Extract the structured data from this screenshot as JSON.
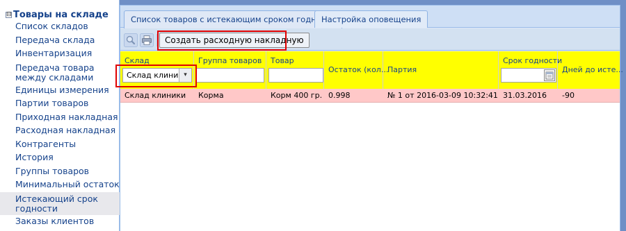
{
  "sidebar": {
    "title": "Товары на складе",
    "expander": "⊟",
    "items": [
      {
        "label": "Список складов",
        "lines": 1
      },
      {
        "label": "Передача склада",
        "lines": 1
      },
      {
        "label": "Инвентаризация",
        "lines": 1
      },
      {
        "label": "Передача товара между складами",
        "lines": 2
      },
      {
        "label": "Единицы измерения",
        "lines": 1
      },
      {
        "label": "Партии товаров",
        "lines": 1
      },
      {
        "label": "Приходная накладная",
        "lines": 1
      },
      {
        "label": "Расходная накладная",
        "lines": 1
      },
      {
        "label": "Контрагенты",
        "lines": 1
      },
      {
        "label": "История",
        "lines": 1
      },
      {
        "label": "Группы товаров",
        "lines": 1
      },
      {
        "label": "Минимальный остаток",
        "lines": 1
      },
      {
        "label": "Истекающий срок годности",
        "lines": 2,
        "active": true
      },
      {
        "label": "Заказы клиентов",
        "lines": 1
      }
    ]
  },
  "tabs": [
    {
      "label": "Список товаров с истекающим сроком годности",
      "active": true
    },
    {
      "label": "Настройка оповещения",
      "active": false
    }
  ],
  "toolbar": {
    "search_icon": "magnifier-icon",
    "print_icon": "printer-icon",
    "create_button": "Создать расходную накладную"
  },
  "grid": {
    "columns": [
      {
        "label": "Склад",
        "filter": "combo",
        "filter_value": "Склад клиники"
      },
      {
        "label": "Группа товаров",
        "filter": "text",
        "filter_value": ""
      },
      {
        "label": "Товар",
        "filter": "text",
        "filter_value": ""
      },
      {
        "label": "Остаток (кол...",
        "filter": "none"
      },
      {
        "label": "Партия",
        "filter": "none"
      },
      {
        "label": "Срок годности",
        "filter": "date",
        "filter_value": ""
      },
      {
        "label": "Дней до исте...",
        "filter": "none"
      }
    ],
    "rows": [
      [
        "Склад клиники",
        "Корма",
        "Корм 400 гр.",
        "0.998",
        "№ 1 от 2016-03-09 10:32:41",
        "31.03.2016",
        "-90"
      ]
    ]
  },
  "colors": {
    "header_bg": "#ffff00",
    "row_highlight": "#ffc8c8",
    "annotation": "#e00000",
    "accent": "#15428b"
  }
}
